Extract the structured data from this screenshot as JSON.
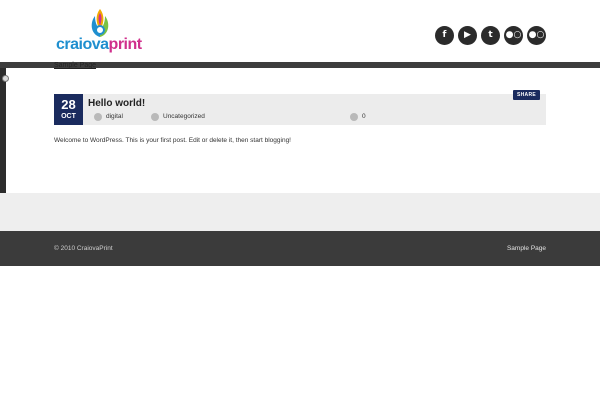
{
  "header": {
    "logo": {
      "text_part1": "craiova",
      "text_part2": "print"
    },
    "social_icons": [
      {
        "icon": "facebook-icon",
        "glyph": "f"
      },
      {
        "icon": "youtube-icon",
        "glyph": "▶"
      },
      {
        "icon": "twitter-icon",
        "glyph": "t"
      },
      {
        "icon": "flickr-icon",
        "glyph": "●○"
      },
      {
        "icon": "flickr-icon",
        "glyph": "●○"
      }
    ]
  },
  "nav": {
    "sample_page_label": "Sample Page"
  },
  "post": {
    "date_day": "28",
    "date_month": "OCT",
    "title": "Hello world!",
    "author": "digital",
    "category": "Uncategorized",
    "comments": "0",
    "share_label": "SHARE",
    "excerpt": "Welcome to WordPress. This is your first post. Edit or delete it, then start blogging!"
  },
  "footer": {
    "copyright": "© 2010 CraiovaPrint",
    "link": "Sample Page"
  },
  "colors": {
    "accent": "#1a2b5e",
    "logo_blue": "#1f8fcf",
    "logo_pink": "#d02f8c",
    "footer_bg": "#3b3b3b"
  }
}
